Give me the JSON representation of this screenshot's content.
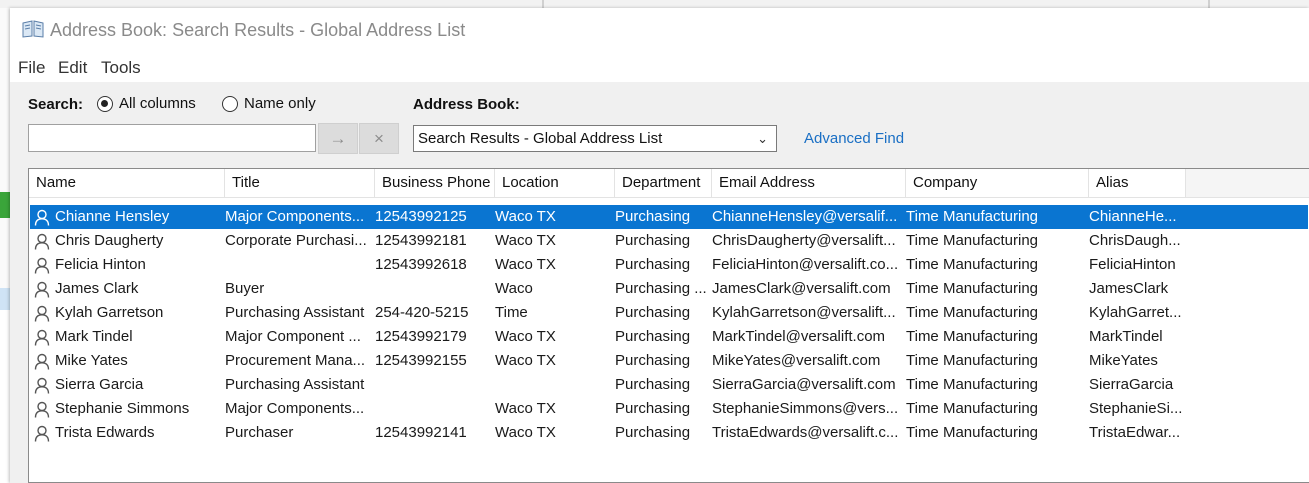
{
  "window": {
    "title": "Address Book: Search Results - Global Address List"
  },
  "menu": [
    "File",
    "Edit",
    "Tools"
  ],
  "search": {
    "label": "Search:",
    "value": "",
    "options": [
      {
        "label": "All columns",
        "checked": true
      },
      {
        "label": "Name only",
        "checked": false
      }
    ],
    "go_symbol": "→",
    "clear_symbol": "×"
  },
  "address_book": {
    "label": "Address Book:",
    "selected": "Search Results - Global Address List",
    "advanced_find": "Advanced Find"
  },
  "columns": [
    "Name",
    "Title",
    "Business Phone",
    "Location",
    "Department",
    "Email Address",
    "Company",
    "Alias"
  ],
  "rows": [
    [
      "Chianne Hensley",
      "Major Components...",
      "12543992125",
      "Waco TX",
      "Purchasing",
      "ChianneHensley@versalif...",
      "Time Manufacturing",
      "ChianneHe..."
    ],
    [
      "Chris Daugherty",
      "Corporate Purchasi...",
      "12543992181",
      "Waco TX",
      "Purchasing",
      "ChrisDaugherty@versalift...",
      "Time Manufacturing",
      "ChrisDaugh..."
    ],
    [
      "Felicia Hinton",
      "",
      "12543992618",
      "Waco TX",
      "Purchasing",
      "FeliciaHinton@versalift.co...",
      "Time Manufacturing",
      "FeliciaHinton"
    ],
    [
      "James Clark",
      "Buyer",
      "",
      "Waco",
      "Purchasing ...",
      "JamesClark@versalift.com",
      "Time Manufacturing",
      "JamesClark"
    ],
    [
      "Kylah Garretson",
      "Purchasing Assistant",
      "254-420-5215",
      "Time",
      "Purchasing",
      "KylahGarretson@versalift...",
      "Time Manufacturing",
      "KylahGarret..."
    ],
    [
      "Mark Tindel",
      "Major Component ...",
      "12543992179",
      "Waco TX",
      "Purchasing",
      "MarkTindel@versalift.com",
      "Time Manufacturing",
      "MarkTindel"
    ],
    [
      "Mike Yates",
      "Procurement Mana...",
      "12543992155",
      "Waco TX",
      "Purchasing",
      "MikeYates@versalift.com",
      "Time Manufacturing",
      "MikeYates"
    ],
    [
      "Sierra Garcia",
      "Purchasing Assistant",
      "",
      "",
      "Purchasing",
      "SierraGarcia@versalift.com",
      "Time Manufacturing",
      "SierraGarcia"
    ],
    [
      "Stephanie Simmons",
      "Major Components...",
      "",
      "Waco TX",
      "Purchasing",
      "StephanieSimmons@vers...",
      "Time Manufacturing",
      "StephanieSi..."
    ],
    [
      "Trista Edwards",
      "Purchaser",
      "12543992141",
      "Waco TX",
      "Purchasing",
      "TristaEdwards@versalift.c...",
      "Time Manufacturing",
      "TristaEdwar..."
    ]
  ],
  "selected_row": 0,
  "colors": {
    "selection": "#0a75d1",
    "link": "#1a6fc4"
  }
}
